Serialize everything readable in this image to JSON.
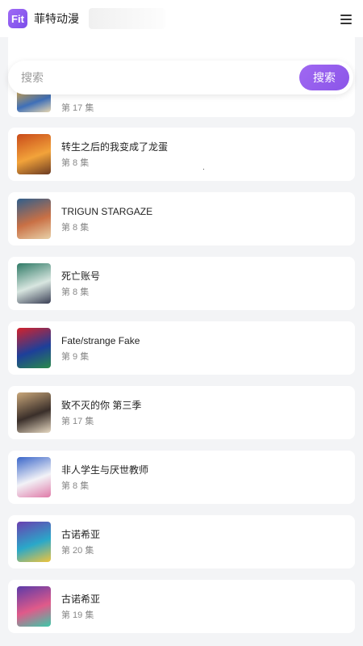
{
  "app": {
    "logo_text": "Fit",
    "title": "菲特动漫"
  },
  "header": {
    "menu_icon": "hamburger-menu-icon"
  },
  "search": {
    "placeholder": "搜索",
    "value": "",
    "button_label": "搜索"
  },
  "colors": {
    "accent": "#9462ee",
    "background": "#f3f4f6",
    "card": "#ffffff"
  },
  "items": [
    {
      "title": "",
      "episode": "第 17 集",
      "thumb_colors": [
        "#d9a84a",
        "#3e6fb8",
        "#e8d7b0"
      ]
    },
    {
      "title": "转生之后的我变成了龙蛋",
      "episode": "第 8 集",
      "thumb_colors": [
        "#c94b1a",
        "#f2a33a",
        "#6b3b22"
      ]
    },
    {
      "title": "TRIGUN STARGAZE",
      "episode": "第 8 集",
      "thumb_colors": [
        "#2f5e8c",
        "#c97045",
        "#e8d1a8"
      ]
    },
    {
      "title": "死亡账号",
      "episode": "第 8 集",
      "thumb_colors": [
        "#2f7a66",
        "#d8e6e0",
        "#3a3f55"
      ]
    },
    {
      "title": "Fate/strange Fake",
      "episode": "第 9 集",
      "thumb_colors": [
        "#d4212b",
        "#1d3f9a",
        "#2a8a4a"
      ]
    },
    {
      "title": "致不灭的你 第三季",
      "episode": "第 17 集",
      "thumb_colors": [
        "#c9a77a",
        "#3a2f2a",
        "#e7d9c2"
      ]
    },
    {
      "title": "非人学生与厌世教师",
      "episode": "第 8 集",
      "thumb_colors": [
        "#3a66c9",
        "#f2f2f7",
        "#e07aa8"
      ]
    },
    {
      "title": "古诺希亚",
      "episode": "第 20 集",
      "thumb_colors": [
        "#6a3fb0",
        "#2aa8c9",
        "#f0c43a"
      ]
    },
    {
      "title": "古诺希亚",
      "episode": "第 19 集",
      "thumb_colors": [
        "#5b3aa8",
        "#e05a8a",
        "#3ac9a8"
      ]
    }
  ]
}
